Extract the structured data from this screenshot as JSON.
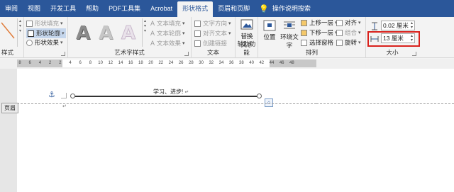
{
  "tabs": [
    {
      "label": "审阅"
    },
    {
      "label": "视图"
    },
    {
      "label": "开发工具"
    },
    {
      "label": "帮助"
    },
    {
      "label": "PDF工具集"
    },
    {
      "label": "Acrobat"
    },
    {
      "label": "形状格式"
    },
    {
      "label": "页眉和页脚"
    }
  ],
  "active_tab": "形状格式",
  "tell_me": "操作说明搜索",
  "shape_styles": {
    "fill": "形状填充",
    "outline": "形状轮廓",
    "effects": "形状效果",
    "group_label": "样式"
  },
  "wordart": {
    "letter": "A",
    "text_fill": "文本填充",
    "text_outline": "文本轮廓",
    "text_effects": "文本效果",
    "group_label": "艺术字样式"
  },
  "text_group": {
    "direction": "文字方向",
    "align": "对齐文本",
    "link": "创建链接",
    "group_label": "文本"
  },
  "accessibility": {
    "alt_text_line1": "替换",
    "alt_text_line2": "文字",
    "group_label": "辅助功能"
  },
  "arrange": {
    "position": "位置",
    "wrap_line1": "环绕文",
    "wrap_line2": "字",
    "bring_forward": "上移一层",
    "send_backward": "下移一层",
    "selection_pane": "选择窗格",
    "align": "对齐",
    "group": "组合",
    "rotate": "旋转",
    "group_label": "排列"
  },
  "size": {
    "height": "0.02 厘米",
    "width": "13 厘米",
    "group_label": "大小"
  },
  "ruler_ticks": [
    "8",
    "6",
    "4",
    "2",
    "2",
    "4",
    "6",
    "8",
    "10",
    "12",
    "14",
    "16",
    "18",
    "20",
    "22",
    "24",
    "26",
    "28",
    "30",
    "32",
    "34",
    "36",
    "38",
    "40",
    "42",
    "44",
    "46",
    "48"
  ],
  "document": {
    "line_text": "学习、进步!",
    "header_label": "页眉",
    "para_mark": "↵"
  },
  "colors": {
    "ribbon_blue": "#2b579a",
    "highlight_red": "#d9211c"
  }
}
